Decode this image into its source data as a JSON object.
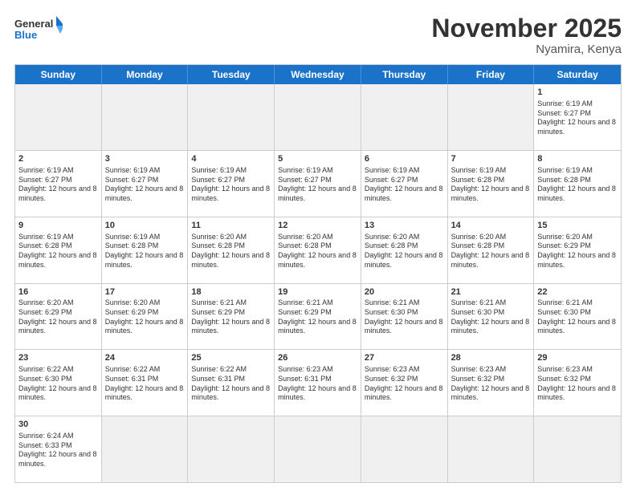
{
  "header": {
    "logo": {
      "general": "General",
      "blue": "Blue"
    },
    "title": "November 2025",
    "location": "Nyamira, Kenya"
  },
  "weekdays": [
    "Sunday",
    "Monday",
    "Tuesday",
    "Wednesday",
    "Thursday",
    "Friday",
    "Saturday"
  ],
  "weeks": [
    [
      {
        "day": "",
        "empty": true
      },
      {
        "day": "",
        "empty": true
      },
      {
        "day": "",
        "empty": true
      },
      {
        "day": "",
        "empty": true
      },
      {
        "day": "",
        "empty": true
      },
      {
        "day": "",
        "empty": true
      },
      {
        "day": "1",
        "sunrise": "6:19 AM",
        "sunset": "6:27 PM",
        "daylight": "12 hours and 8 minutes."
      }
    ],
    [
      {
        "day": "2",
        "sunrise": "6:19 AM",
        "sunset": "6:27 PM",
        "daylight": "12 hours and 8 minutes."
      },
      {
        "day": "3",
        "sunrise": "6:19 AM",
        "sunset": "6:27 PM",
        "daylight": "12 hours and 8 minutes."
      },
      {
        "day": "4",
        "sunrise": "6:19 AM",
        "sunset": "6:27 PM",
        "daylight": "12 hours and 8 minutes."
      },
      {
        "day": "5",
        "sunrise": "6:19 AM",
        "sunset": "6:27 PM",
        "daylight": "12 hours and 8 minutes."
      },
      {
        "day": "6",
        "sunrise": "6:19 AM",
        "sunset": "6:27 PM",
        "daylight": "12 hours and 8 minutes."
      },
      {
        "day": "7",
        "sunrise": "6:19 AM",
        "sunset": "6:28 PM",
        "daylight": "12 hours and 8 minutes."
      },
      {
        "day": "8",
        "sunrise": "6:19 AM",
        "sunset": "6:28 PM",
        "daylight": "12 hours and 8 minutes."
      }
    ],
    [
      {
        "day": "9",
        "sunrise": "6:19 AM",
        "sunset": "6:28 PM",
        "daylight": "12 hours and 8 minutes."
      },
      {
        "day": "10",
        "sunrise": "6:19 AM",
        "sunset": "6:28 PM",
        "daylight": "12 hours and 8 minutes."
      },
      {
        "day": "11",
        "sunrise": "6:20 AM",
        "sunset": "6:28 PM",
        "daylight": "12 hours and 8 minutes."
      },
      {
        "day": "12",
        "sunrise": "6:20 AM",
        "sunset": "6:28 PM",
        "daylight": "12 hours and 8 minutes."
      },
      {
        "day": "13",
        "sunrise": "6:20 AM",
        "sunset": "6:28 PM",
        "daylight": "12 hours and 8 minutes."
      },
      {
        "day": "14",
        "sunrise": "6:20 AM",
        "sunset": "6:28 PM",
        "daylight": "12 hours and 8 minutes."
      },
      {
        "day": "15",
        "sunrise": "6:20 AM",
        "sunset": "6:29 PM",
        "daylight": "12 hours and 8 minutes."
      }
    ],
    [
      {
        "day": "16",
        "sunrise": "6:20 AM",
        "sunset": "6:29 PM",
        "daylight": "12 hours and 8 minutes."
      },
      {
        "day": "17",
        "sunrise": "6:20 AM",
        "sunset": "6:29 PM",
        "daylight": "12 hours and 8 minutes."
      },
      {
        "day": "18",
        "sunrise": "6:21 AM",
        "sunset": "6:29 PM",
        "daylight": "12 hours and 8 minutes."
      },
      {
        "day": "19",
        "sunrise": "6:21 AM",
        "sunset": "6:29 PM",
        "daylight": "12 hours and 8 minutes."
      },
      {
        "day": "20",
        "sunrise": "6:21 AM",
        "sunset": "6:30 PM",
        "daylight": "12 hours and 8 minutes."
      },
      {
        "day": "21",
        "sunrise": "6:21 AM",
        "sunset": "6:30 PM",
        "daylight": "12 hours and 8 minutes."
      },
      {
        "day": "22",
        "sunrise": "6:21 AM",
        "sunset": "6:30 PM",
        "daylight": "12 hours and 8 minutes."
      }
    ],
    [
      {
        "day": "23",
        "sunrise": "6:22 AM",
        "sunset": "6:30 PM",
        "daylight": "12 hours and 8 minutes."
      },
      {
        "day": "24",
        "sunrise": "6:22 AM",
        "sunset": "6:31 PM",
        "daylight": "12 hours and 8 minutes."
      },
      {
        "day": "25",
        "sunrise": "6:22 AM",
        "sunset": "6:31 PM",
        "daylight": "12 hours and 8 minutes."
      },
      {
        "day": "26",
        "sunrise": "6:23 AM",
        "sunset": "6:31 PM",
        "daylight": "12 hours and 8 minutes."
      },
      {
        "day": "27",
        "sunrise": "6:23 AM",
        "sunset": "6:32 PM",
        "daylight": "12 hours and 8 minutes."
      },
      {
        "day": "28",
        "sunrise": "6:23 AM",
        "sunset": "6:32 PM",
        "daylight": "12 hours and 8 minutes."
      },
      {
        "day": "29",
        "sunrise": "6:23 AM",
        "sunset": "6:32 PM",
        "daylight": "12 hours and 8 minutes."
      }
    ],
    [
      {
        "day": "30",
        "sunrise": "6:24 AM",
        "sunset": "6:33 PM",
        "daylight": "12 hours and 8 minutes."
      },
      {
        "day": "",
        "empty": true
      },
      {
        "day": "",
        "empty": true
      },
      {
        "day": "",
        "empty": true
      },
      {
        "day": "",
        "empty": true
      },
      {
        "day": "",
        "empty": true
      },
      {
        "day": "",
        "empty": true
      }
    ]
  ]
}
